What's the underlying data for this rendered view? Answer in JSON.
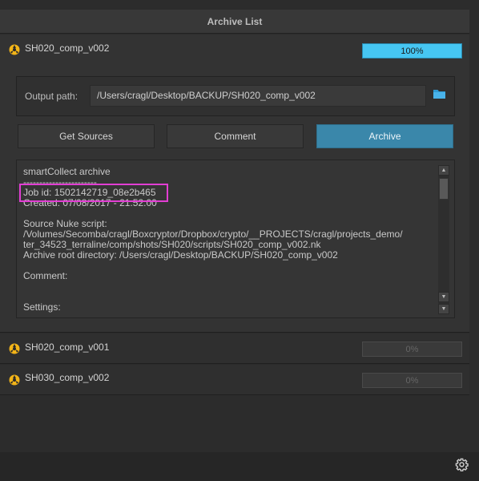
{
  "window": {
    "title": "Archive List"
  },
  "jobs": [
    {
      "name": "SH020_comp_v002",
      "progress": 100,
      "progress_label": "100%",
      "expanded": true
    },
    {
      "name": "SH020_comp_v001",
      "progress": 0,
      "progress_label": "0%",
      "expanded": false
    },
    {
      "name": "SH030_comp_v002",
      "progress": 0,
      "progress_label": "0%",
      "expanded": false
    }
  ],
  "output": {
    "label": "Output path:",
    "value": "/Users/cragl/Desktop/BACKUP/SH020_comp_v002"
  },
  "buttons": {
    "get_sources": "Get Sources",
    "comment": "Comment",
    "archive": "Archive"
  },
  "log": {
    "text": "smartCollect archive\n-----------------------\nJob id: 1502142719_08e2b465\nCreated: 07/08/2017 - 21:52:00\n\nSource Nuke script:\n/Volumes/Secomba/cragl/Boxcryptor/Dropbox/crypto/__PROJECTS/cragl/projects_demo/\nter_34523_terraline/comp/shots/SH020/scripts/SH020_comp_v002.nk\nArchive root directory: /Users/cragl/Desktop/BACKUP/SH020_comp_v002\n\nComment:\n\n\nSettings:"
  },
  "colors": {
    "accent": "#3a87aa",
    "progress_fill": "#46c6f2",
    "highlight": "#e23ed3",
    "nuke_icon": "#f2b418"
  },
  "icons": {
    "job": "nuke-icon",
    "folder": "folder-icon",
    "settings": "gear-icon"
  }
}
